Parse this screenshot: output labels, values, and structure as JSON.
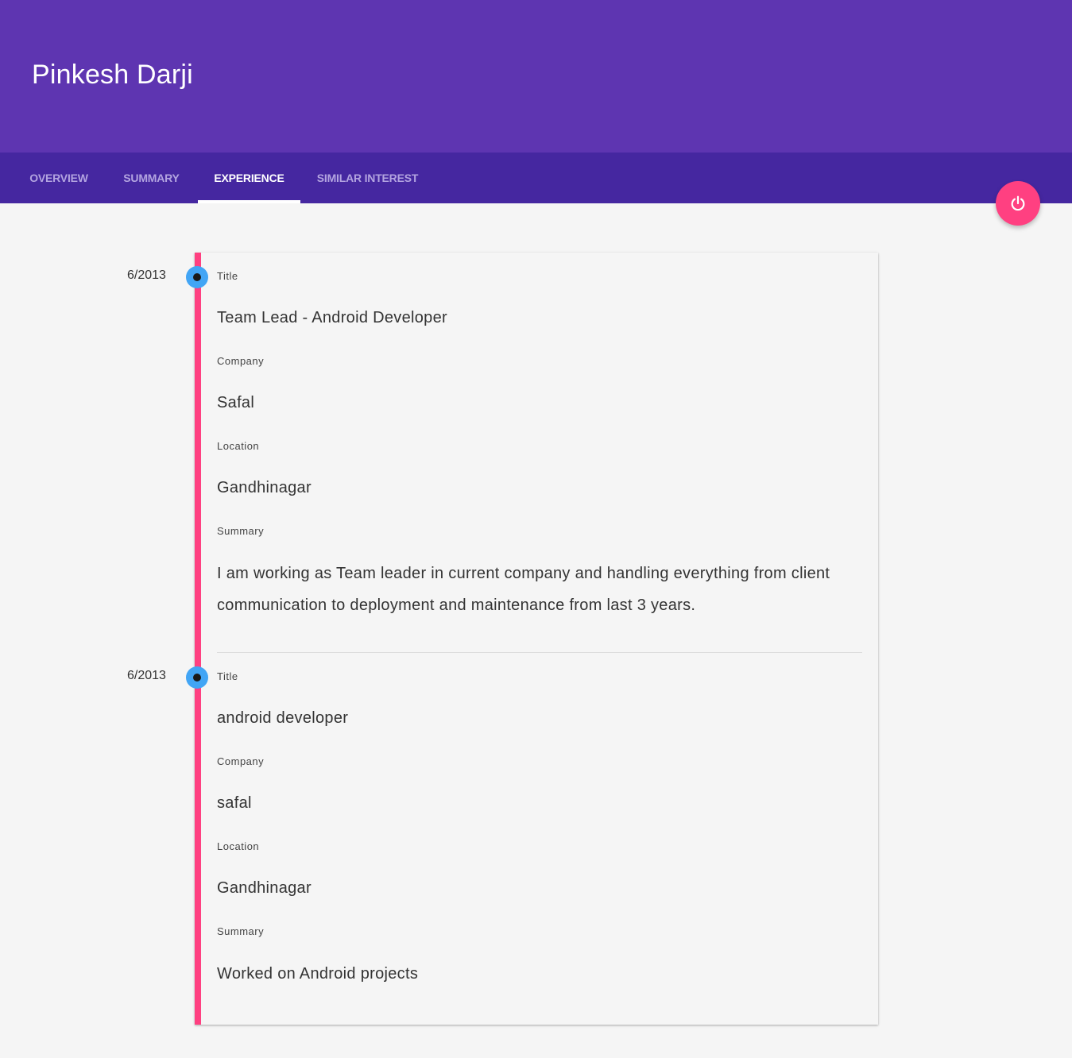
{
  "header": {
    "title": "Pinkesh Darji"
  },
  "tabs": [
    {
      "label": "OVERVIEW",
      "active": false
    },
    {
      "label": "SUMMARY",
      "active": false
    },
    {
      "label": "EXPERIENCE",
      "active": true
    },
    {
      "label": "SIMILAR INTEREST",
      "active": false
    }
  ],
  "fab": {
    "icon": "power-icon"
  },
  "colors": {
    "header": "#5e35b1",
    "tabbar": "#4527a0",
    "accent": "#ff4081",
    "timeline_dot": "#42a5f5"
  },
  "experience": [
    {
      "date": "6/2013",
      "title_label": "Title",
      "title": "Team Lead - Android Developer",
      "company_label": "Company",
      "company": "Safal",
      "location_label": "Location",
      "location": "Gandhinagar",
      "summary_label": "Summary",
      "summary": "I am working as Team leader in current company and handling everything from client communication to deployment and maintenance from last 3 years."
    },
    {
      "date": "6/2013",
      "title_label": "Title",
      "title": "android developer",
      "company_label": "Company",
      "company": "safal",
      "location_label": "Location",
      "location": "Gandhinagar",
      "summary_label": "Summary",
      "summary": "Worked on Android projects"
    }
  ]
}
